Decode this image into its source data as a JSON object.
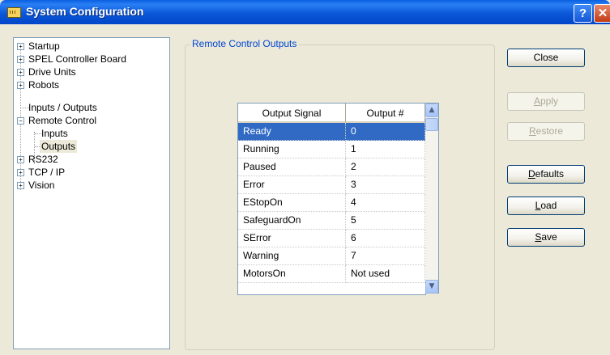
{
  "window": {
    "title": "System Configuration",
    "help_label": "?",
    "close_label": "✕"
  },
  "tree": {
    "items": [
      {
        "label": "Startup",
        "expander": "+"
      },
      {
        "label": "SPEL Controller Board",
        "expander": "+"
      },
      {
        "label": "Drive Units",
        "expander": "+"
      },
      {
        "label": "Robots",
        "expander": "+"
      },
      {
        "label": "Inputs / Outputs",
        "expander": ""
      },
      {
        "label": "Remote Control",
        "expander": "−"
      },
      {
        "label": "Inputs",
        "expander": ""
      },
      {
        "label": "Outputs",
        "expander": ""
      },
      {
        "label": "RS232",
        "expander": "+"
      },
      {
        "label": "TCP / IP",
        "expander": "+"
      },
      {
        "label": "Vision",
        "expander": "+"
      }
    ],
    "selected": "Outputs"
  },
  "group": {
    "label": "Remote Control Outputs"
  },
  "grid": {
    "columns": [
      "Output Signal",
      "Output #"
    ],
    "rows": [
      [
        "Ready",
        "0"
      ],
      [
        "Running",
        "1"
      ],
      [
        "Paused",
        "2"
      ],
      [
        "Error",
        "3"
      ],
      [
        "EStopOn",
        "4"
      ],
      [
        "SafeguardOn",
        "5"
      ],
      [
        "SError",
        "6"
      ],
      [
        "Warning",
        "7"
      ],
      [
        "MotorsOn",
        "Not used"
      ]
    ],
    "selected_row": 0
  },
  "buttons": {
    "close": "Close",
    "apply": "Apply",
    "restore": "Restore",
    "defaults": "Defaults",
    "load": "Load",
    "save": "Save"
  },
  "colors": {
    "title_bar": "#0b58d8",
    "selection": "#316ac5",
    "group_label": "#0046d5",
    "dialog_bg": "#ece9d8"
  }
}
